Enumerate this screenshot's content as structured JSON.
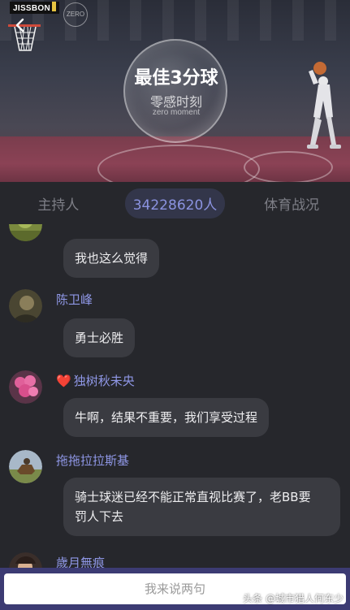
{
  "video": {
    "brand": "JISSBON",
    "sub_brand": "ZERO",
    "headline": "最佳3分球",
    "subline": "零感时刻",
    "subline_en": "zero moment"
  },
  "tabs": [
    {
      "label": "主持人",
      "active": false
    },
    {
      "label": "34228620人",
      "active": true
    },
    {
      "label": "体育战况",
      "active": false
    }
  ],
  "messages": [
    {
      "user": "",
      "text": "我也这么觉得",
      "avatar": "green-avatar"
    },
    {
      "user": "陈卫峰",
      "text": "勇士必胜",
      "avatar": "dark-avatar"
    },
    {
      "user": "独树秋未央",
      "text": "牛啊，结果不重要，我们享受过程",
      "heart": "❤️",
      "avatar": "flower-avatar"
    },
    {
      "user": "拖拖拉拉斯基",
      "text_line1": "骑士球迷已经不能正常直视比赛了，老BB要",
      "text_line2": "罚人下去",
      "avatar": "horse-avatar"
    },
    {
      "user": "歲月無痕",
      "avatar": "portrait-avatar"
    }
  ],
  "input": {
    "placeholder": "我来说两句"
  },
  "watermark": "头条 @城市猎人何东少",
  "colors": {
    "background": "#26272c",
    "username": "#8f97e6",
    "bubble": "#3a3b41",
    "tab_active": "#8b93e0",
    "input_bar": "#3c3b73"
  }
}
